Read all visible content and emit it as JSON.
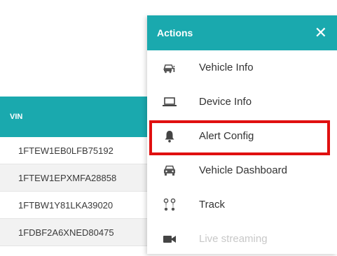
{
  "table": {
    "header": "VIN",
    "rows": [
      "1FTEW1EB0LFB75192",
      "1FTEW1EPXMFA28858",
      "1FTBW1Y81LKA39020",
      "1FDBF2A6XNED80475"
    ]
  },
  "menu": {
    "title": "Actions",
    "close": "✕",
    "items": [
      {
        "label": "Vehicle Info",
        "icon": "vehicle-info-icon"
      },
      {
        "label": "Device Info",
        "icon": "laptop-icon"
      },
      {
        "label": "Alert Config",
        "icon": "bell-icon"
      },
      {
        "label": "Vehicle Dashboard",
        "icon": "car-front-icon"
      },
      {
        "label": "Track",
        "icon": "route-icon"
      },
      {
        "label": "Live streaming",
        "icon": "video-camera-icon",
        "disabled": true
      }
    ]
  },
  "colors": {
    "accent": "#1aa9ae",
    "highlight": "#e01010"
  }
}
